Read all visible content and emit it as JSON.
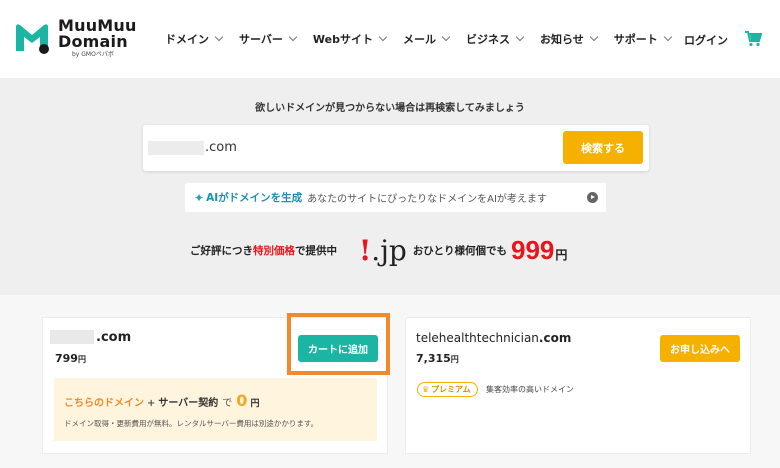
{
  "header": {
    "logo": {
      "line1": "MuuMuu",
      "line2": "Domain",
      "by": "by GMOペパボ",
      "brand_color": "#1cb5a3"
    },
    "nav": [
      {
        "label": "ドメイン"
      },
      {
        "label": "サーバー"
      },
      {
        "label": "Webサイト"
      },
      {
        "label": "メール"
      },
      {
        "label": "ビジネス"
      },
      {
        "label": "お知らせ"
      },
      {
        "label": "サポート"
      }
    ],
    "login": "ログイン",
    "cart_icon": "cart-icon"
  },
  "search": {
    "caption": "欲しいドメインが見つからない場合は再検索してみましょう",
    "value_suffix": ".com",
    "button": "検索する",
    "button_color": "#f5b000"
  },
  "ai_banner": {
    "title": "AIがドメインを生成",
    "description": "あなたのサイトにぴったりなドメインをAIが考えます"
  },
  "promo": {
    "prefix": "ご好評につき",
    "highlight": "特別価格",
    "suffix": "で提供中",
    "jp_logo_bang": "!",
    "jp_logo_text": ".jp",
    "sub": "おひとり様何個でも",
    "price": "999",
    "yen": "円"
  },
  "results": {
    "left": {
      "tld": ".com",
      "price": "799",
      "yen": "円",
      "add_to_cart": "カートに追加",
      "bundle": {
        "part1": "こちらのドメイン",
        "plus": "+",
        "part2": "サーバー契約",
        "de": "で",
        "zero": "0",
        "yen": "円",
        "note": "ドメイン取得・更新費用が無料。レンタルサーバー費用は別途かかります。"
      }
    },
    "right": {
      "name": "telehealthtechnician",
      "tld": ".com",
      "price": "7,315",
      "yen": "円",
      "apply": "お申し込みへ",
      "badge": "プレミアム",
      "badge_icon": "crown-icon",
      "description": "集客効率の高いドメイン"
    }
  }
}
